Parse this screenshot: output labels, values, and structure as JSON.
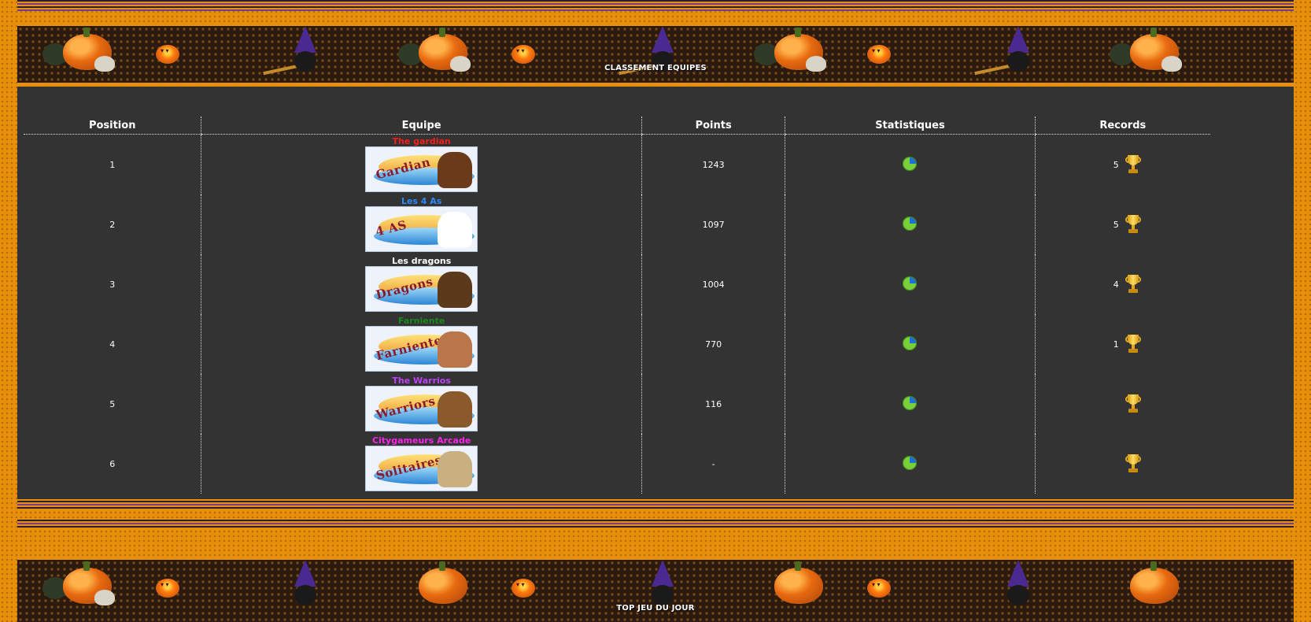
{
  "top_banner": {
    "title": "CLASSEMENT EQUIPES"
  },
  "bottom_banner": {
    "title": "TOP JEU DU JOUR"
  },
  "table": {
    "headers": [
      "Position",
      "Equipe",
      "Points",
      "Statistiques",
      "Records"
    ],
    "rows": [
      {
        "position": "1",
        "team": "The gardian",
        "team_color": "#ff1a1a",
        "logo_text": "Gardian",
        "points": "1243",
        "records": "5"
      },
      {
        "position": "2",
        "team": "Les 4 As",
        "team_color": "#2a8cff",
        "logo_text": "4 AS",
        "points": "1097",
        "records": "5"
      },
      {
        "position": "3",
        "team": "Les dragons",
        "team_color": "#ffffff",
        "logo_text": "Dragons",
        "points": "1004",
        "records": "4"
      },
      {
        "position": "4",
        "team": "Farniente",
        "team_color": "#1a8a1a",
        "logo_text": "Farniente",
        "points": "770",
        "records": "1"
      },
      {
        "position": "5",
        "team": "The Warrios",
        "team_color": "#c040ff",
        "logo_text": "Warriors",
        "points": "116",
        "records": ""
      },
      {
        "position": "6",
        "team": "Citygameurs Arcade",
        "team_color": "#ff22ee",
        "logo_text": "Solitaires",
        "points": "-",
        "records": ""
      }
    ]
  },
  "icons": {
    "stats": "pie-chart-icon",
    "records": "trophy-icon"
  }
}
